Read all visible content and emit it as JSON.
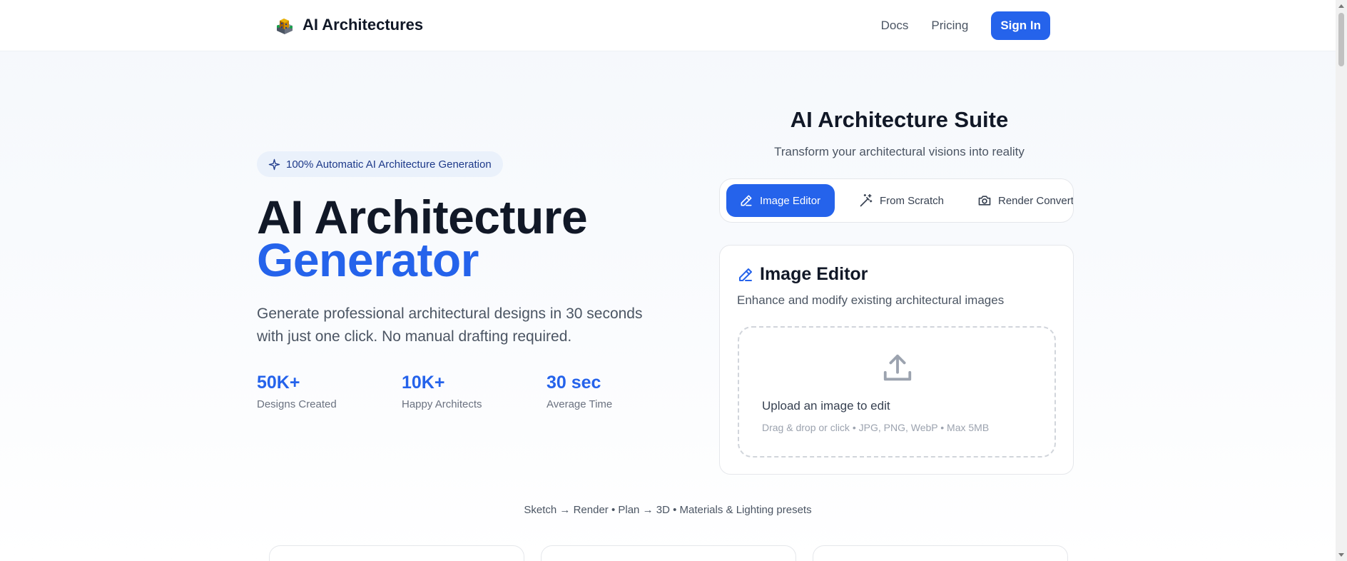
{
  "header": {
    "brand": "AI Architectures",
    "nav": {
      "docs": "Docs",
      "pricing": "Pricing",
      "signin": "Sign In"
    }
  },
  "hero": {
    "badge": "100% Automatic AI Architecture Generation",
    "title_line1": "AI Architecture",
    "title_line2": "Generator",
    "description": "Generate professional architectural designs in 30 seconds with just one click. No manual drafting required.",
    "stats": [
      {
        "value": "50K+",
        "label": "Designs Created"
      },
      {
        "value": "10K+",
        "label": "Happy Architects"
      },
      {
        "value": "30 sec",
        "label": "Average Time"
      }
    ]
  },
  "suite": {
    "title": "AI Architecture Suite",
    "subtitle": "Transform your architectural visions into reality",
    "tabs": [
      {
        "label": "Image Editor",
        "icon": "pencil-icon",
        "active": true
      },
      {
        "label": "From Scratch",
        "icon": "magic-wand-icon",
        "active": false
      },
      {
        "label": "Render Converte",
        "icon": "camera-icon",
        "active": false
      }
    ],
    "card": {
      "title": "Image Editor",
      "subtitle": "Enhance and modify existing architectural images",
      "upload_title": "Upload an image to edit",
      "upload_hint": "Drag & drop or click • JPG, PNG, WebP • Max 5MB"
    }
  },
  "caption": "Sketch → Render • Plan → 3D • Materials & Lighting presets",
  "colors": {
    "accent": "#2563eb",
    "text": "#111827",
    "muted": "#6b7280"
  }
}
